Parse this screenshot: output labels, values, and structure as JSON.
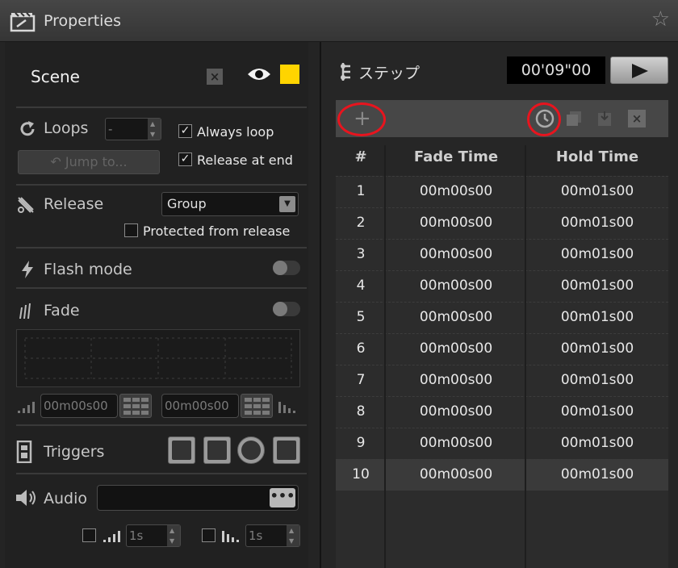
{
  "window": {
    "title": "Properties"
  },
  "scene": {
    "label": "Scene",
    "color": "#ffd400"
  },
  "loops": {
    "label": "Loops",
    "value": "-",
    "jump_button": "Jump to...",
    "always_loop": "Always loop",
    "release_at_end": "Release at end"
  },
  "release": {
    "label": "Release",
    "mode": "Group",
    "protected_label": "Protected from release"
  },
  "flash": {
    "label": "Flash mode"
  },
  "fade": {
    "label": "Fade",
    "fade_in": "00m00s00",
    "fade_out": "00m00s00"
  },
  "triggers": {
    "label": "Triggers"
  },
  "audio": {
    "label": "Audio",
    "dots": "•••",
    "fade_in": "1s",
    "fade_out": "1s"
  },
  "steps": {
    "label": "ステップ",
    "time": "00'09\"00",
    "plus": "+",
    "columns": {
      "num": "#",
      "fade": "Fade Time",
      "hold": "Hold Time"
    },
    "rows": [
      {
        "num": "1",
        "fade": "00m00s00",
        "hold": "00m01s00"
      },
      {
        "num": "2",
        "fade": "00m00s00",
        "hold": "00m01s00"
      },
      {
        "num": "3",
        "fade": "00m00s00",
        "hold": "00m01s00"
      },
      {
        "num": "4",
        "fade": "00m00s00",
        "hold": "00m01s00"
      },
      {
        "num": "5",
        "fade": "00m00s00",
        "hold": "00m01s00"
      },
      {
        "num": "6",
        "fade": "00m00s00",
        "hold": "00m01s00"
      },
      {
        "num": "7",
        "fade": "00m00s00",
        "hold": "00m01s00"
      },
      {
        "num": "8",
        "fade": "00m00s00",
        "hold": "00m01s00"
      },
      {
        "num": "9",
        "fade": "00m00s00",
        "hold": "00m01s00"
      },
      {
        "num": "10",
        "fade": "00m00s00",
        "hold": "00m01s00"
      }
    ]
  }
}
